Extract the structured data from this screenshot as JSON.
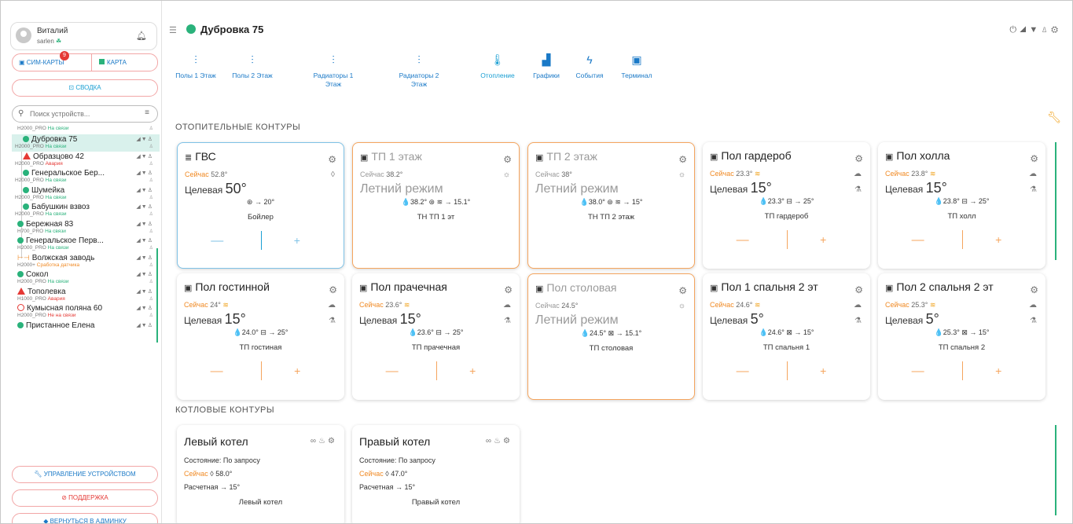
{
  "user": {
    "name": "Виталий",
    "login": "sarlen"
  },
  "sidebar": {
    "sim_label": "СИМ-КАРТЫ",
    "sim_badge": "9",
    "map_label": "КАРТА",
    "summary_label": "СВОДКА",
    "search_placeholder": "Поиск устройств...",
    "management_label": "УПРАВЛЕНИЕ УСТРОЙСТВОМ",
    "support_label": "ПОДДЕРЖКА",
    "admin_label": "ВЕРНУТЬСЯ В АДМИНКУ",
    "devices": [
      {
        "name": "",
        "model": "H2000_PRO",
        "status": "На связи",
        "status_type": "ok",
        "kind": "header-only"
      },
      {
        "name": "Дубровка 75",
        "model": "H2000_PRO",
        "status": "На связи",
        "status_type": "ok",
        "marker": "dot",
        "child": true,
        "selected": true
      },
      {
        "name": "Образцово 42",
        "model": "H2000_PRO",
        "status": "Авария",
        "status_type": "alarm",
        "marker": "triangle",
        "child": true
      },
      {
        "name": "Генеральское Бер...",
        "model": "H2000_PRO",
        "status": "На связи",
        "status_type": "ok",
        "marker": "dot",
        "child": true
      },
      {
        "name": "Шумейка",
        "model": "H2000_PRO",
        "status": "На связи",
        "status_type": "ok",
        "marker": "dot",
        "child": true
      },
      {
        "name": "Бабушкин взвоз",
        "model": "H2000_PRO",
        "status": "На связи",
        "status_type": "ok",
        "marker": "dot",
        "child": true
      },
      {
        "name": "Бережная 83",
        "model": "H700_PRO",
        "status": "На связи",
        "status_type": "ok",
        "marker": "dot"
      },
      {
        "name": "Генеральское Перв...",
        "model": "H2000_PRO",
        "status": "На связи",
        "status_type": "ok",
        "marker": "dot"
      },
      {
        "name": "Волжская заводь",
        "model": "H2000+",
        "status": "Сработка датчика",
        "status_type": "warn",
        "marker": "orange"
      },
      {
        "name": "Сокол",
        "model": "H2000_PRO",
        "status": "На связи",
        "status_type": "ok",
        "marker": "dot"
      },
      {
        "name": "Тополевка",
        "model": "H1000_PRO",
        "status": "Авария",
        "status_type": "alarm",
        "marker": "triangle"
      },
      {
        "name": "Кумысная поляна 60",
        "model": "H2000_PRO",
        "status": "Не на связи",
        "status_type": "alarm",
        "marker": "ring"
      },
      {
        "name": "Пристанное Елена",
        "model": "",
        "status": "",
        "status_type": "ok",
        "marker": "dot"
      }
    ]
  },
  "header": {
    "device_title": "Дубровка 75"
  },
  "tabs": [
    {
      "line1": "Полы 1 Этаж",
      "line2": ""
    },
    {
      "line1": "Полы 2 Этаж",
      "line2": ""
    },
    {
      "line1": "Радиаторы 1",
      "line2": "Этаж"
    },
    {
      "line1": "Радиаторы 2",
      "line2": "Этаж"
    },
    {
      "line1": "Отопление",
      "line2": ""
    },
    {
      "line1": "Графики",
      "line2": ""
    },
    {
      "line1": "События",
      "line2": ""
    },
    {
      "line1": "Терминал",
      "line2": ""
    }
  ],
  "sections": {
    "heating": "ОТОПИТЕЛЬНЫЕ КОНТУРЫ",
    "boilers": "КОТЛОВЫЕ КОНТУРЫ"
  },
  "cards": [
    {
      "title": "ГВС",
      "now_label": "Сейчас",
      "now_value": "52.8°",
      "target_label": "Целевая",
      "target_value": "50°",
      "info": "⊛ → 20°",
      "sensor": "Бойлер",
      "style": "blue"
    },
    {
      "title": "ТП 1 этаж",
      "now_label": "Сейчас",
      "now_value": "38.2°",
      "summer": "Летний режим",
      "info": "💧38.2° ⊛ ≋ → 15.1°",
      "sensor": "ТН ТП 1 эт",
      "style": "orange"
    },
    {
      "title": "ТП 2 этаж",
      "now_label": "Сейчас",
      "now_value": "38°",
      "summer": "Летний режим",
      "info": "💧38.0° ⊛ ≋ → 15°",
      "sensor": "ТН ТП 2 этаж",
      "style": "orange"
    },
    {
      "title": "Пол гардероб",
      "now_label": "Сейчас",
      "now_value": "23.3°",
      "target_label": "Целевая",
      "target_value": "15°",
      "info": "💧23.3° ⊟ → 25°",
      "sensor": "ТП гардероб",
      "style": "normal"
    },
    {
      "title": "Пол холла",
      "now_label": "Сейчас",
      "now_value": "23.8°",
      "target_label": "Целевая",
      "target_value": "15°",
      "info": "💧23.8° ⊟ → 25°",
      "sensor": "ТП холл",
      "style": "normal"
    },
    {
      "title": "Пол гостинной",
      "now_label": "Сейчас",
      "now_value": "24°",
      "target_label": "Целевая",
      "target_value": "15°",
      "info": "💧24.0° ⊟ → 25°",
      "sensor": "ТП гостиная",
      "style": "normal"
    },
    {
      "title": "Пол прачечная",
      "now_label": "Сейчас",
      "now_value": "23.6°",
      "target_label": "Целевая",
      "target_value": "15°",
      "info": "💧23.6° ⊟ → 25°",
      "sensor": "ТП прачечная",
      "style": "normal"
    },
    {
      "title": "Пол столовая",
      "now_label": "Сейчас",
      "now_value": "24.5°",
      "summer": "Летний режим",
      "info": "💧24.5° ⊠ → 15.1°",
      "sensor": "ТП столовая",
      "style": "orange"
    },
    {
      "title": "Пол 1 спальня 2 эт",
      "now_label": "Сейчас",
      "now_value": "24.6°",
      "target_label": "Целевая",
      "target_value": "5°",
      "info": "💧24.6° ⊠ → 15°",
      "sensor": "ТП спальня 1",
      "style": "normal"
    },
    {
      "title": "Пол 2 спальня 2 эт",
      "now_label": "Сейчас",
      "now_value": "25.3°",
      "target_label": "Целевая",
      "target_value": "5°",
      "info": "💧25.3° ⊠ → 15°",
      "sensor": "ТП спальня 2",
      "style": "normal"
    }
  ],
  "boilers": [
    {
      "title": "Левый котел",
      "state": "Состояние: По запросу",
      "now_label": "Сейчас",
      "now_value": "58.0°",
      "calc": "Расчетная → 15°",
      "name": "Левый котел"
    },
    {
      "title": "Правый котел",
      "state": "Состояние: По запросу",
      "now_label": "Сейчас",
      "now_value": "47.0°",
      "calc": "Расчетная → 15°",
      "name": "Правый котел"
    }
  ],
  "colors": {
    "accent": "#1a79c7",
    "ok": "#2ab27b",
    "alarm": "#e53935",
    "warn": "#f08a24",
    "summer_border": "#f5a55e",
    "active_border": "#7fc2e6"
  }
}
